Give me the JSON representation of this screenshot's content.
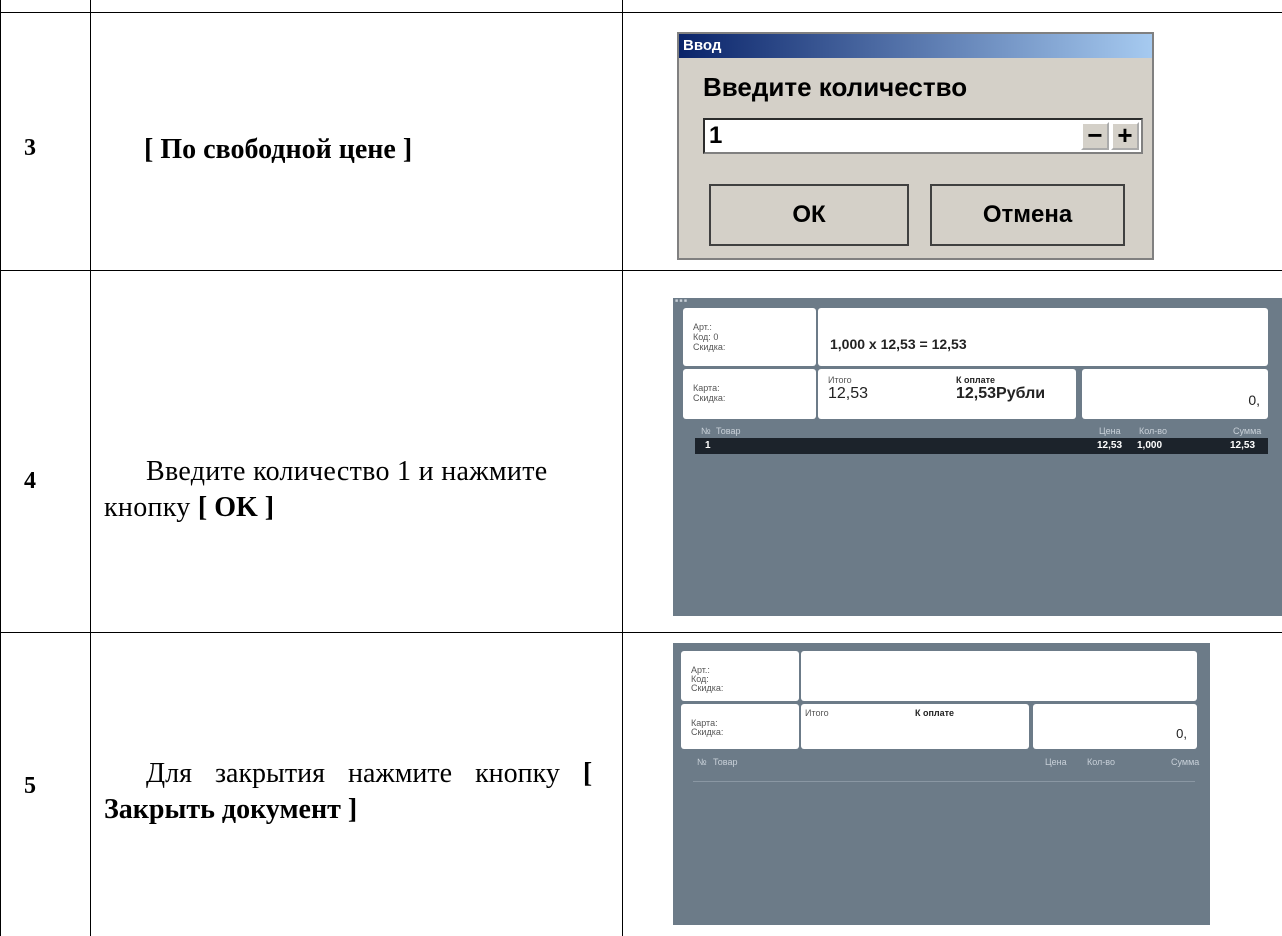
{
  "rows": [
    {
      "number": "3",
      "description": "[ По свободной цене ]"
    },
    {
      "number": "4",
      "description_text": "Введите количество 1 и нажмите кнопку ",
      "description_bold": "[ OK ]"
    },
    {
      "number": "5",
      "description_text": "Для закрытия нажмите кнопку ",
      "description_bold": "[ Закрыть документ ]"
    }
  ],
  "dialog": {
    "title": "Ввод",
    "prompt": "Введите количество",
    "value": "1",
    "minus": "−",
    "plus": "+",
    "ok_label": "ОК",
    "cancel_label": "Отмена",
    "title_color": "#0a246a"
  },
  "pos1": {
    "art_label": "Арт.:",
    "code_label": "Код:",
    "code_value": "0",
    "discount_label": "Скидка:",
    "calc": "1,000 x 12,53 = 12,53",
    "card_label": "Карта:",
    "card_discount_label": "Скидка:",
    "total_label": "Итого",
    "total_value": "12,53",
    "pay_label": "К оплате",
    "pay_value": "12,53Рубли",
    "change_value": "0,",
    "columns": [
      "№",
      "Товар",
      "Цена",
      "Кол-во",
      "Сумма"
    ],
    "items": [
      {
        "no": "1",
        "name": "",
        "price": "12,53",
        "qty": "1,000",
        "sum": "12,53"
      }
    ],
    "bg_color": "#6c7b88"
  },
  "pos2": {
    "art_label": "Арт.:",
    "code_label": "Код:",
    "discount_label": "Скидка:",
    "card_label": "Карта:",
    "card_discount_label": "Скидка:",
    "total_label": "Итого",
    "pay_label": "К оплате",
    "change_value": "0,",
    "columns": [
      "№",
      "Товар",
      "Цена",
      "Кол-во",
      "Сумма"
    ]
  }
}
